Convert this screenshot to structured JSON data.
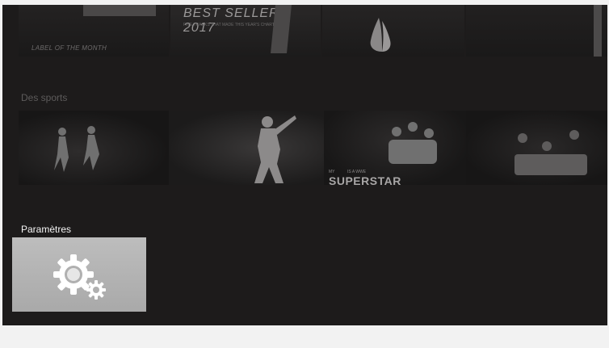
{
  "top_row": {
    "tiles": [
      {
        "label": "LABEL OF THE MONTH"
      },
      {
        "title": "BEST SELLERS 2017",
        "subtitle": "FIVE TRACKS THAT MADE THIS YEAR'S CHARTS"
      },
      {
        "icon": "praying-hands-icon"
      },
      {
        "icon": "figure-icon"
      }
    ]
  },
  "sports": {
    "title": "Des sports",
    "tiles": [
      {
        "name": "sport-tile-soccer"
      },
      {
        "name": "sport-tile-baseball"
      },
      {
        "name": "sport-tile-wrestling",
        "my": "MY",
        "is_a_wwe": "IS A WWE",
        "superstar": "SUPERSTAR"
      },
      {
        "name": "sport-tile-crowd"
      }
    ]
  },
  "settings": {
    "title": "Paramètres",
    "icon": "gear-icon",
    "tile_color": "#b4b4b4"
  }
}
